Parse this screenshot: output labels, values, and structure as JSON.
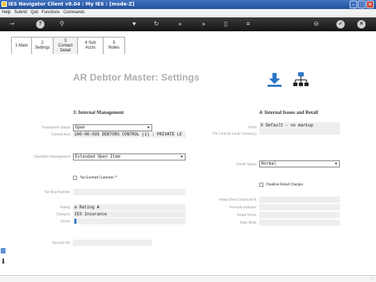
{
  "window": {
    "title": "IES Navigator Client v8.04 : My IES :     [mode-Z]"
  },
  "menu": [
    "Help",
    "Submit",
    "Quit",
    "Functions",
    "Commands"
  ],
  "tabs": [
    {
      "label": "1 Main"
    },
    {
      "label": "2 Settings"
    },
    {
      "label": "3 Contact Detail"
    },
    {
      "label": "4 Sub Accts"
    },
    {
      "label": "5 Notes"
    }
  ],
  "page_title": "AR Debtor Master: Settings",
  "section3": {
    "title": "3: Internal Management",
    "transaction_status_label": "Transaction Status",
    "transaction_status_value": "Open",
    "control_acct_label": "Control Acct",
    "control_acct_value": "100-00-035 DEBTORS CONTROL (1) : PRIVATE LE",
    "openitem_label": "OpenItem Management",
    "openitem_value": "Extended Open Item",
    "tax_exempt_label": "Tax Exempt Customer ?",
    "tax_reg_label": "Tax Reg Number",
    "tax_reg_value": "",
    "rating_label": "Rating",
    "rating_value": "a Rating A",
    "category_label": "Category",
    "category_value": "IES Insurance",
    "group_label": "Group",
    "group_value": "",
    "security_label": "Security No",
    "security_value": ""
  },
  "section4": {
    "title": "4: Internal Issues and Retail",
    "profit_label": "Profit",
    "profit_sub_label": "Pin Limit (in Local Currency)",
    "profit_value": "0 Default - no markup",
    "credit_status_label": "Credit Status",
    "credit_status_value": "Normal",
    "disallow_retail_label": "Disallow Retail Charges",
    "retail_direct_label": "Retail Direct Discount %",
    "retail_direct_value": "",
    "formula_label": "Formula Indicator",
    "formula_value": "",
    "retail_terms_label": "Retail Terms",
    "retail_terms_value": "",
    "rate_book_label": "Rate Book",
    "rate_book_value": ""
  }
}
